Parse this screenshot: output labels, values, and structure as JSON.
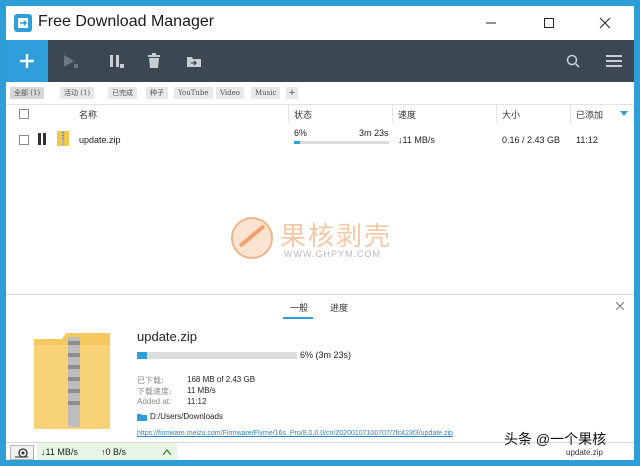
{
  "app": {
    "title": "Free Download Manager"
  },
  "filters": [
    {
      "label": "全部 (1)",
      "active": true
    },
    {
      "label": "活动 (1)",
      "active": false
    },
    {
      "label": "已完成",
      "active": false
    },
    {
      "label": "种子",
      "active": false
    },
    {
      "label": "YouTube",
      "active": false
    },
    {
      "label": "Video",
      "active": false
    },
    {
      "label": "Music",
      "active": false
    }
  ],
  "filter_add": "+",
  "columns": {
    "name": "名称",
    "status": "状态",
    "speed": "速度",
    "size": "大小",
    "added": "已添加"
  },
  "download": {
    "name": "update.zip",
    "percent": "6%",
    "progress": 0.06,
    "time_left": "3m 23s",
    "speed": "↓11 MB/s",
    "size": "0.16 / 2.43 GB",
    "added": "11:12"
  },
  "watermark": {
    "text": "果核剥壳",
    "url": "WWW.GHPYM.COM"
  },
  "details": {
    "tab_general": "一般",
    "tab_progress": "进度",
    "filename": "update.zip",
    "progress_text": "6% (3m 23s)",
    "downloaded_label": "已下载:",
    "downloaded_value": "168 MB of 2.43 GB",
    "speed_label": "下载速度:",
    "speed_value": "11 MB/s",
    "added_label": "Added at:",
    "added_value": "11:12",
    "folder": "D:/Users/Downloads",
    "url": "https://firmware.meizu.com/Firmware/Flyme/16s_Pro/8.0.0.0/cn/20200107100707/7fc423f3/update.zip"
  },
  "status": {
    "down": "↓11 MB/s",
    "up": "↑0 B/s",
    "overlay": "头条 @一个果核",
    "overlay2": "update.zip"
  },
  "colors": {
    "accent": "#2e9fdb",
    "toolbar": "#3b4854"
  }
}
